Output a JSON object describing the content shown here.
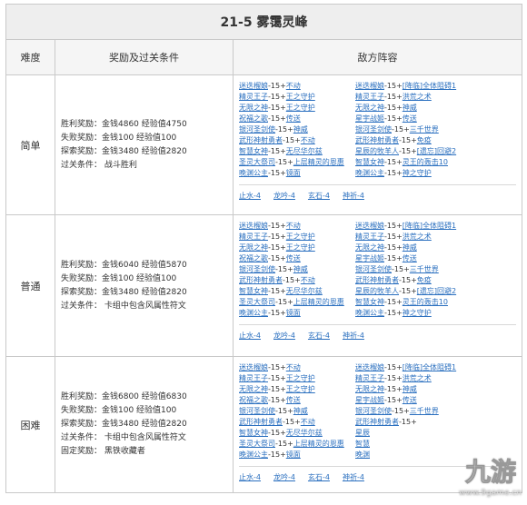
{
  "title": "21-5 雾霭灵峰",
  "headers": {
    "difficulty": "难度",
    "rewards": "奖励及过关条件",
    "enemies": "敌方阵容"
  },
  "rows": [
    {
      "difficulty": "简单",
      "conditions": [
        "胜利奖励：金钱4860 经验值4750",
        "失败奖励：金钱100 经验值100",
        "探索奖励：金钱3480 经验值2820",
        "过关条件：  战斗胜利"
      ],
      "left": [
        {
          "name": "迷迭榴娘",
          "level": "-15+",
          "skill": "不动"
        },
        {
          "name": "精灵王子",
          "level": "-15+",
          "skill": "王之守护"
        },
        {
          "name": "无限之神",
          "level": "-15+",
          "skill": "王之守护"
        },
        {
          "name": "祝福之歌",
          "level": "-15+",
          "skill": "传送"
        },
        {
          "name": "银河圣剑使",
          "level": "-15+",
          "skill": "神威"
        },
        {
          "name": "武形神射勇者",
          "level": "-15+",
          "skill": "不动"
        },
        {
          "name": "智慧女神",
          "level": "-15+",
          "skill": "无尽华尔兹"
        },
        {
          "name": "圣灵大祭司",
          "level": "-15+",
          "skill": "上层精灵的恩惠"
        },
        {
          "name": "晚渊公主",
          "level": "-15+",
          "skill": "镜面"
        }
      ],
      "right": [
        {
          "name": "迷迭榴娘",
          "level": "-15+",
          "skill": "[降临]全体阻碍1"
        },
        {
          "name": "精灵王子",
          "level": "-15+",
          "skill": "洪荒之术"
        },
        {
          "name": "无限之神",
          "level": "-15+",
          "skill": "神威"
        },
        {
          "name": "星宇战姬",
          "level": "-15+",
          "skill": "传送"
        },
        {
          "name": "银河圣剑使",
          "level": "-15+",
          "skill": "三千世界"
        },
        {
          "name": "武形神射勇者",
          "level": "-15+",
          "skill": "免疫"
        },
        {
          "name": "星辰的牧羊人",
          "level": "-15+",
          "skill": "[遗忘]回避2"
        },
        {
          "name": "智慧女神",
          "level": "-15+",
          "skill": "灵王的轰击10"
        },
        {
          "name": "晚渊公主",
          "level": "-15+",
          "skill": "神之守护"
        }
      ],
      "relics": [
        "止水-4",
        "龙吟-4",
        "玄石-4",
        "神祈-4"
      ]
    },
    {
      "difficulty": "普通",
      "conditions": [
        "胜利奖励：金钱6040 经验值5870",
        "失败奖励：金钱100 经验值100",
        "探索奖励：金钱3480 经验值2820",
        "过关条件：  卡组中包含风属性符文"
      ],
      "left": [
        {
          "name": "迷迭榴娘",
          "level": "-15+",
          "skill": "不动"
        },
        {
          "name": "精灵王子",
          "level": "-15+",
          "skill": "王之守护"
        },
        {
          "name": "无限之神",
          "level": "-15+",
          "skill": "王之守护"
        },
        {
          "name": "祝福之歌",
          "level": "-15+",
          "skill": "传送"
        },
        {
          "name": "银河圣剑使",
          "level": "-15+",
          "skill": "神威"
        },
        {
          "name": "武形神射勇者",
          "level": "-15+",
          "skill": "不动"
        },
        {
          "name": "智慧女神",
          "level": "-15+",
          "skill": "无尽华尔兹"
        },
        {
          "name": "圣灵大祭司",
          "level": "-15+",
          "skill": "上层精灵的恩惠"
        },
        {
          "name": "晚渊公主",
          "level": "-15+",
          "skill": "镜面"
        }
      ],
      "right": [
        {
          "name": "迷迭榴娘",
          "level": "-15+",
          "skill": "[降临]全体阻碍1"
        },
        {
          "name": "精灵王子",
          "level": "-15+",
          "skill": "洪荒之术"
        },
        {
          "name": "无限之神",
          "level": "-15+",
          "skill": "神威"
        },
        {
          "name": "星宇战姬",
          "level": "-15+",
          "skill": "传送"
        },
        {
          "name": "银河圣剑使",
          "level": "-15+",
          "skill": "三千世界"
        },
        {
          "name": "武形神射勇者",
          "level": "-15+",
          "skill": "免疫"
        },
        {
          "name": "星辰的牧羊人",
          "level": "-15+",
          "skill": "[遗忘]回避2"
        },
        {
          "name": "智慧女神",
          "level": "-15+",
          "skill": "灵王的轰击10"
        },
        {
          "name": "晚渊公主",
          "level": "-15+",
          "skill": "神之守护"
        }
      ],
      "relics": [
        "止水-4",
        "龙吟-4",
        "玄石-4",
        "神祈-4"
      ]
    },
    {
      "difficulty": "困难",
      "conditions": [
        "胜利奖励：金钱6800 经验值6830",
        "失败奖励：金钱100 经验值100",
        "探索奖励：金钱3480 经验值2820",
        "过关条件：  卡组中包含风属性符文",
        "固定奖励：  黑铁收藏者"
      ],
      "left": [
        {
          "name": "迷迭榴娘",
          "level": "-15+",
          "skill": "不动"
        },
        {
          "name": "精灵王子",
          "level": "-15+",
          "skill": "王之守护"
        },
        {
          "name": "无限之神",
          "level": "-15+",
          "skill": "王之守护"
        },
        {
          "name": "祝福之歌",
          "level": "-15+",
          "skill": "传送"
        },
        {
          "name": "银河圣剑使",
          "level": "-15+",
          "skill": "神威"
        },
        {
          "name": "武形神射勇者",
          "level": "-15+",
          "skill": "不动"
        },
        {
          "name": "智慧女神",
          "level": "-15+",
          "skill": "无尽华尔兹"
        },
        {
          "name": "圣灵大祭司",
          "level": "-15+",
          "skill": "上层精灵的恩惠"
        },
        {
          "name": "晚渊公主",
          "level": "-15+",
          "skill": "镜面"
        }
      ],
      "right": [
        {
          "name": "迷迭榴娘",
          "level": "-15+",
          "skill": "[降临]全体阻碍1"
        },
        {
          "name": "精灵王子",
          "level": "-15+",
          "skill": "洪荒之术"
        },
        {
          "name": "无限之神",
          "level": "-15+",
          "skill": "神威"
        },
        {
          "name": "星宇战姬",
          "level": "-15+",
          "skill": "传送"
        },
        {
          "name": "银河圣剑使",
          "level": "-15+",
          "skill": "三千世界"
        },
        {
          "name": "武形神射勇者",
          "level": "-15+",
          "skill": ""
        },
        {
          "name": "星辰",
          "level": "",
          "skill": ""
        },
        {
          "name": "智慧",
          "level": "",
          "skill": ""
        },
        {
          "name": "晚渊",
          "level": "",
          "skill": ""
        }
      ],
      "relics": [
        "止水-4",
        "龙吟-4",
        "玄石-4",
        "神祈-4"
      ]
    }
  ],
  "watermark": {
    "logo": "九游",
    "url": "www.9game.cn"
  },
  "colors": {
    "link": "#2a6fbf",
    "border": "#c9c9c9",
    "header_bg": "#eeeeee"
  }
}
